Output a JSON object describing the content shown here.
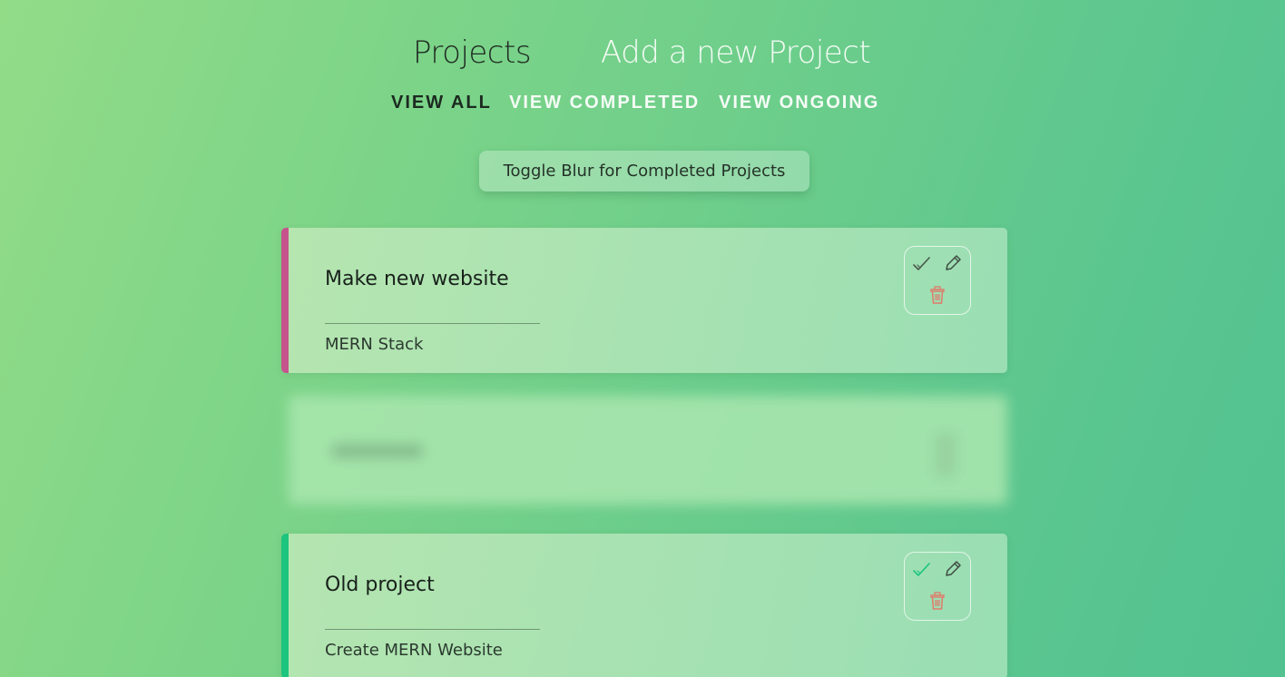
{
  "nav": {
    "projects_label": "Projects",
    "add_label": "Add a new Project"
  },
  "filters": {
    "all": "VIEW ALL",
    "completed": "VIEW COMPLETED",
    "ongoing": "VIEW ONGOING",
    "active": "all"
  },
  "toggle": {
    "label": "Toggle Blur for Completed Projects"
  },
  "projects": [
    {
      "title": "Make new website",
      "details": "MERN Stack",
      "status": "ongoing",
      "stripe_color": "#c4548b",
      "check_color": "#4a5a4e"
    },
    {
      "title": "",
      "details": "",
      "status": "completed",
      "blurred": true
    },
    {
      "title": "Old project",
      "details": "Create MERN Website",
      "status": "ongoing",
      "stripe_color": "#1dc47e",
      "check_color": "#1dc47e"
    }
  ],
  "icons": {
    "check": "check-icon",
    "edit": "pencil-icon",
    "delete": "trash-icon"
  },
  "colors": {
    "delete": "#e07a6a",
    "nav_active": "#1f2a22",
    "nav_inactive": "#f3fbf4"
  }
}
